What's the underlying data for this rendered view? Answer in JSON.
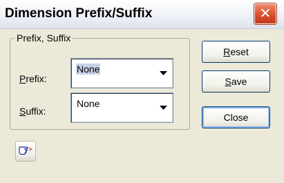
{
  "window": {
    "title": "Dimension Prefix/Suffix",
    "close_glyph": "✕"
  },
  "group": {
    "legend": "Prefix, Suffix",
    "prefix": {
      "label": "Prefix:",
      "mnemonic": "P",
      "rest": "refix:",
      "value": "None"
    },
    "suffix": {
      "label": "Suffix:",
      "mnemonic": "S",
      "rest": "uffix:",
      "value": "None"
    }
  },
  "buttons": {
    "reset": {
      "mnemonic": "R",
      "rest": "eset"
    },
    "save": {
      "mnemonic": "S",
      "rest": "ave"
    },
    "close": {
      "label": "Close"
    }
  },
  "icons": {
    "help": "pointing-hand-help-icon",
    "dropdown": "chevron-down-icon",
    "close": "close-icon"
  }
}
